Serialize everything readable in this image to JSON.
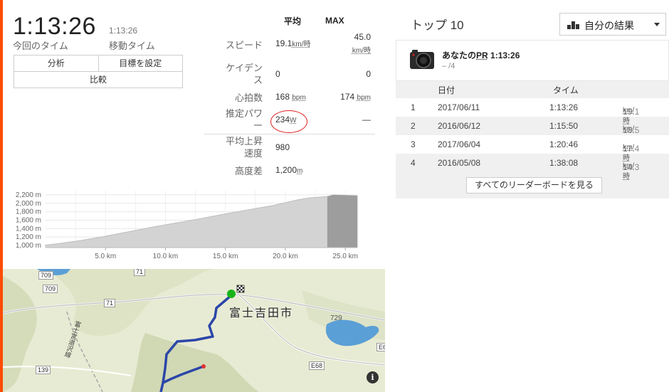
{
  "summary": {
    "elapsed_time": "1:13:26",
    "elapsed_label": "今回のタイム",
    "moving_time": "1:13:26",
    "moving_label": "移動タイム"
  },
  "actions": {
    "analysis": "分析",
    "set_goal": "目標を設定",
    "compare": "比較"
  },
  "stats": {
    "col_avg": "平均",
    "col_max": "MAX",
    "rows": [
      {
        "label": "スピード",
        "avg": "19.1",
        "avg_unit": "km/時",
        "max": "45.0",
        "max_unit": "km/時"
      },
      {
        "label": "ケイデンス",
        "avg": "0",
        "max": "0"
      },
      {
        "label": "心拍数",
        "avg": "168",
        "avg_unit": "bpm",
        "max": "174",
        "max_unit": "bpm"
      },
      {
        "label": "推定パワー",
        "avg": "234",
        "avg_unit": "W",
        "max": "—"
      },
      {
        "label": "平均上昇速度",
        "avg": "980"
      },
      {
        "label": "高度差",
        "avg": "1,200",
        "avg_unit": "m"
      }
    ]
  },
  "chart_data": {
    "type": "area",
    "xlabel": "",
    "ylabel": "",
    "x_ticks": [
      "5.0 km",
      "10.0 km",
      "15.0 km",
      "20.0 km",
      "25.0 km"
    ],
    "y_ticks": [
      "1,000 m",
      "1,200 m",
      "1,400 m",
      "1,600 m",
      "1,800 m",
      "2,000 m",
      "2,200 m"
    ],
    "xlim": [
      0,
      26
    ],
    "ylim": [
      950,
      2300
    ],
    "x": [
      0,
      1,
      3,
      5,
      7,
      9,
      11,
      13,
      15,
      17,
      19,
      21,
      22,
      23.5,
      24,
      25,
      26
    ],
    "y": [
      1010,
      1040,
      1120,
      1220,
      1330,
      1440,
      1540,
      1640,
      1750,
      1850,
      1950,
      2080,
      2130,
      2160,
      2200,
      2190,
      2180
    ],
    "highlight_from_km": 23.5
  },
  "map": {
    "city_label": "富士吉田市",
    "road_labels": [
      "709",
      "709",
      "71",
      "71",
      "729",
      "139",
      "E68",
      "E68"
    ],
    "river_label": "富士宮道沢線",
    "info_icon": "info-icon"
  },
  "leaderboard": {
    "title": "トップ 10",
    "filter_label": "自分の結果",
    "pr_label": "あなたの",
    "pr_abbr": "PR",
    "pr_time": "1:13:26",
    "pr_rank": "– /4",
    "col_date": "日付",
    "col_time": "タイム",
    "rows": [
      {
        "rank": "1",
        "date": "2017/06/11",
        "time": "1:13:26",
        "speed": "19.1",
        "unit": "km/時"
      },
      {
        "rank": "2",
        "date": "2016/06/12",
        "time": "1:15:50",
        "speed": "18.5",
        "unit": "km/時"
      },
      {
        "rank": "3",
        "date": "2017/06/04",
        "time": "1:20:46",
        "speed": "17.4",
        "unit": "km/時"
      },
      {
        "rank": "4",
        "date": "2016/05/08",
        "time": "1:38:08",
        "speed": "14.3",
        "unit": "km/時"
      }
    ],
    "see_all": "すべてのリーダーボードを見る"
  },
  "colors": {
    "accent": "#fc4c02",
    "route": "#2b46a8",
    "start": "#19b319",
    "water": "#5a9fd6",
    "annotation": "#e02020"
  }
}
